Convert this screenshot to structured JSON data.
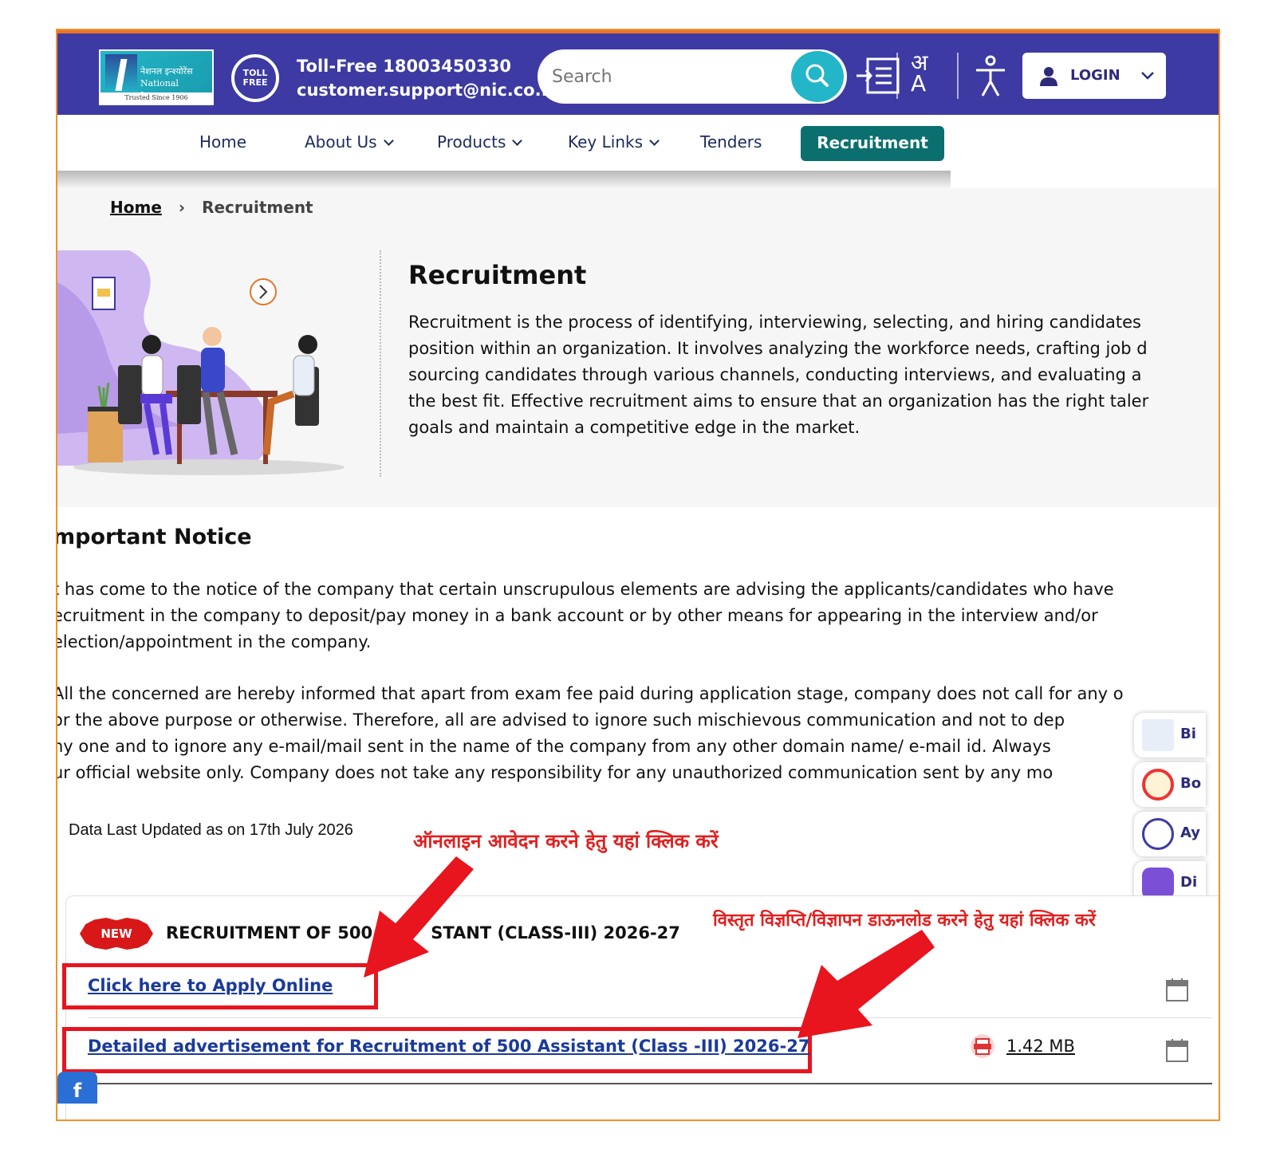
{
  "header": {
    "logo_text": "नेशनल इन्श्योरेंस\nNational Insurance",
    "logo_tagline": "Trusted Since 1906",
    "toll_icon_text": "TOLL FREE",
    "toll_free": "Toll-Free 18003450330",
    "email": "customer.support@nic.co..",
    "search_placeholder": "Search",
    "language_icon_text": "अ A",
    "login_label": "LOGIN"
  },
  "nav": {
    "home": "Home",
    "about": "About Us",
    "products": "Products",
    "key_links": "Key Links",
    "tenders": "Tenders",
    "recruitment": "Recruitment"
  },
  "breadcrumb": {
    "home": "Home",
    "current": "Recruitment"
  },
  "intro": {
    "title": "Recruitment",
    "lines": [
      "Recruitment is the process of identifying, interviewing, selecting, and hiring candidates",
      "position within an organization. It involves analyzing the workforce needs, crafting job d",
      "sourcing candidates through various channels, conducting interviews, and evaluating a",
      "the best fit. Effective recruitment aims to ensure that an organization has the right taler",
      "goals and maintain a competitive edge in the market."
    ]
  },
  "notice": {
    "title": "mportant Notice",
    "para1": [
      "t has come to the notice of the company that certain unscrupulous elements are advising the applicants/candidates who have",
      "ecruitment in the company to deposit/pay money in a bank account or by other means for appearing in the interview and/or",
      "election/appointment in the company."
    ],
    "para2": [
      "All the concerned are hereby informed that apart from exam fee paid during application stage, company does not call for any o",
      "or the above purpose or otherwise. Therefore, all are advised to ignore such mischievous communication and not to dep",
      "ny one and to ignore any e-mail/mail sent in the name of the company from any other domain name/ e-mail id. Always",
      "ur official website only. Company does not take any responsibility for any unauthorized communication sent by any mo"
    ]
  },
  "side_buttons": [
    "Bi",
    "Bo",
    "Ay",
    "Di"
  ],
  "updated": "Data Last Updated as on 17th July 2026",
  "annotations": {
    "apply_hint": "ऑनलाइन आवेदन करने हेतु यहां क्लिक करें",
    "download_hint": "विस्तृत विज्ञप्ति/विज्ञापन डाऊनलोड करने हेतु यहां क्लिक करें"
  },
  "recruitment": {
    "badge": "NEW",
    "heading": "RECRUITMENT OF 500          STANT (CLASS-III) 2026-27",
    "apply_link": "Click here to Apply Online",
    "advert_link": "Detailed advertisement for Recruitment of 500 Assistant (Class -III) 2026-27",
    "file_size": "1.42 MB"
  },
  "social": {
    "facebook": "f"
  },
  "colors": {
    "header_bg": "#3d3aa3",
    "accent_teal": "#0b6f6f",
    "search_button": "#22b6c8",
    "annotation_red": "#e02020",
    "frame_orange": "#f0932b"
  }
}
